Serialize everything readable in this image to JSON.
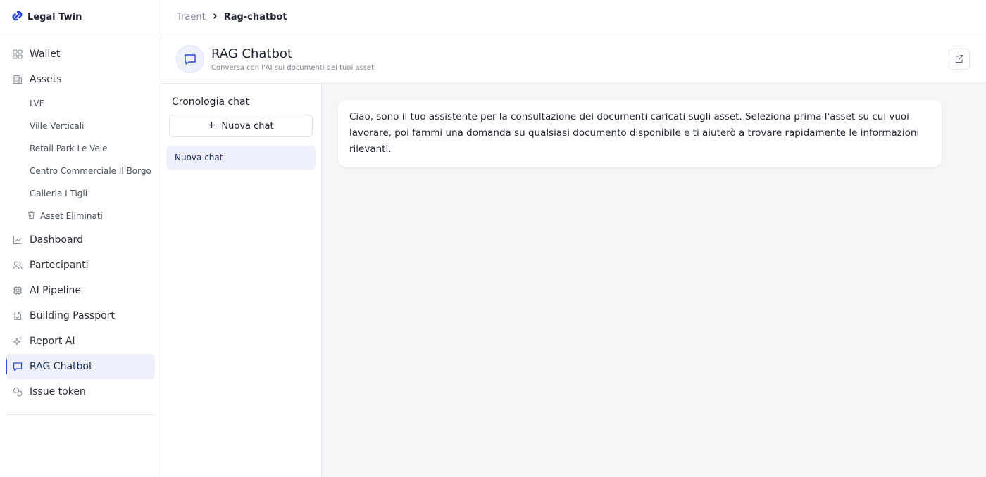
{
  "brand": {
    "name": "Legal Twin",
    "logo_icon": "link-logo-icon",
    "color": "#2c4ad6"
  },
  "breadcrumb": {
    "parent": "Traent",
    "separator": ">",
    "current": "Rag-chatbot"
  },
  "sidebar": {
    "items": [
      {
        "label": "Wallet",
        "icon": "grid-icon"
      },
      {
        "label": "Assets",
        "icon": "building-icon"
      },
      {
        "label": "Dashboard",
        "icon": "chart-icon"
      },
      {
        "label": "Partecipanti",
        "icon": "users-icon"
      },
      {
        "label": "AI Pipeline",
        "icon": "cpu-icon"
      },
      {
        "label": "Building Passport",
        "icon": "document-icon"
      },
      {
        "label": "Report AI",
        "icon": "sparkles-icon"
      },
      {
        "label": "RAG Chatbot",
        "icon": "chat-icon",
        "active": true
      },
      {
        "label": "Issue token",
        "icon": "coins-icon"
      }
    ],
    "assets": [
      "LVF",
      "Ville Verticali",
      "Retail Park Le Vele",
      "Centro Commerciale Il Borgo",
      "Galleria I Tigli"
    ],
    "deleted_assets": "Asset Eliminati"
  },
  "page": {
    "title": "RAG Chatbot",
    "subtitle": "Conversa con l'AI sui documenti dei tuoi asset"
  },
  "history": {
    "title": "Cronologia chat",
    "new_chat_label": "Nuova chat",
    "items": [
      "Nuova chat"
    ]
  },
  "chat": {
    "messages": [
      {
        "role": "assistant",
        "text": "Ciao, sono il tuo assistente per la consultazione dei documenti caricati sugli asset. Seleziona prima l'asset su cui vuoi lavorare, poi fammi una domanda su qualsiasi documento disponibile e ti aiuterò a trovare rapidamente le informazioni rilevanti."
      }
    ]
  },
  "colors": {
    "accent": "#2c4ad6",
    "active_bg": "#eef1fb",
    "chat_bg": "#f5f6f8"
  }
}
